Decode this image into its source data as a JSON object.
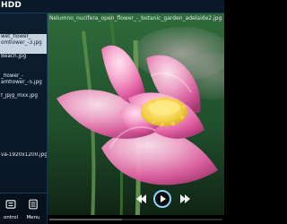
{
  "app": {
    "device_title": "HDD"
  },
  "header": {
    "current_file": "Nelumno_nucifera_open_flower_-_botanic_garden_adelaide2.jpg"
  },
  "sidebar": {
    "items": [
      {
        "line1": "wet_flower_",
        "line2": "omflower_-3.jpg",
        "selected": true
      },
      {
        "line1": "Beach.jpg",
        "line2": "",
        "selected": false
      },
      {
        "line1": "_flower_-",
        "line2": "amflower_-5.jpg",
        "selected": false
      },
      {
        "line1": "f_jpjg_mxx.jpg",
        "line2": "",
        "selected": false
      },
      {
        "line1": "va-1920x1200.jpg",
        "line2": "",
        "selected": false
      }
    ],
    "buttons": {
      "control_label": "ontrol",
      "menu_label": "Menu"
    }
  },
  "player": {
    "progress": 0.42
  }
}
